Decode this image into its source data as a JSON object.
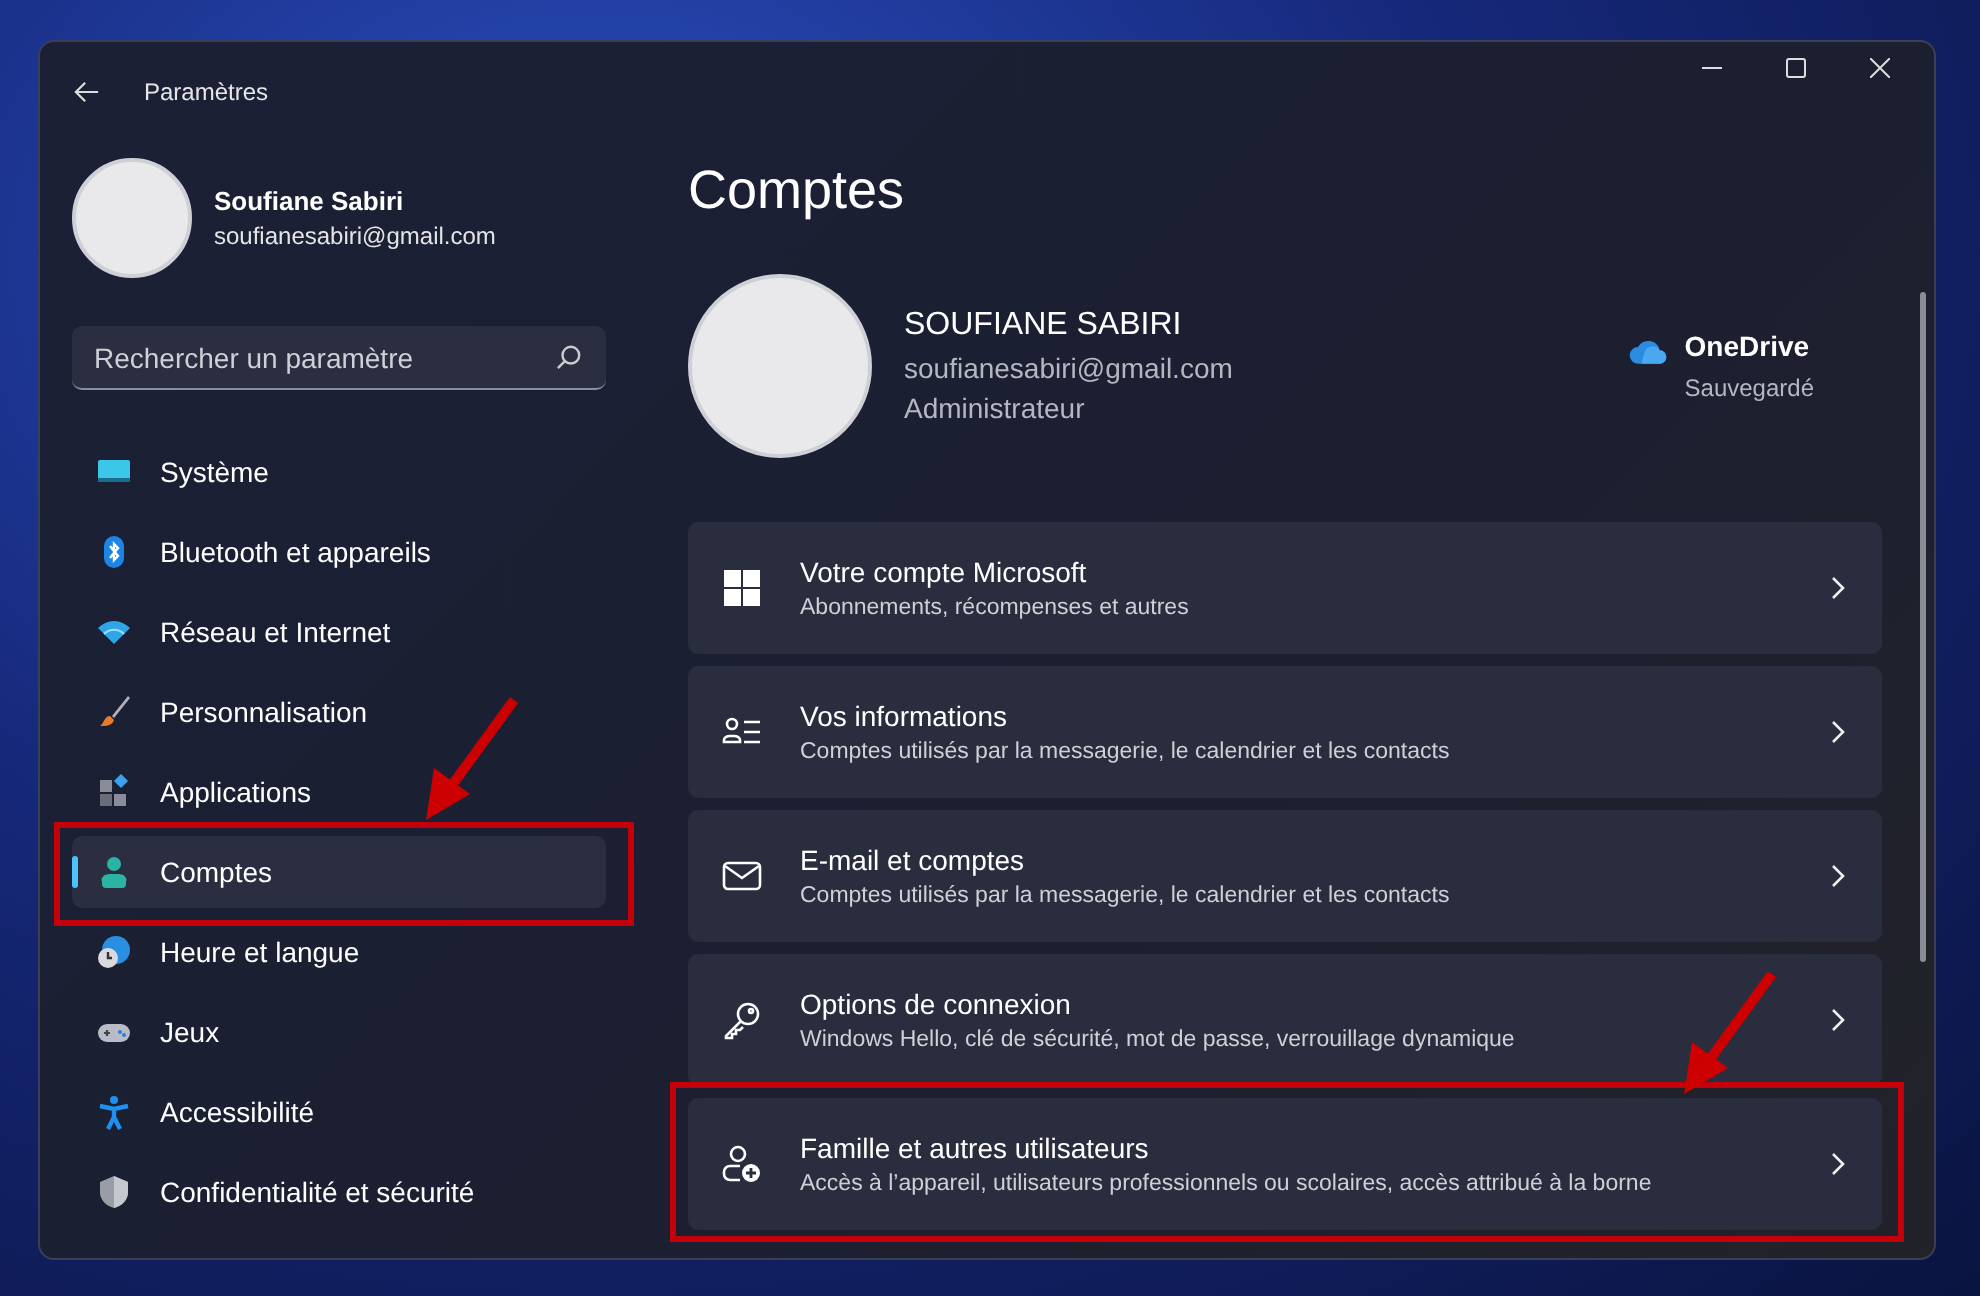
{
  "window": {
    "title": "Paramètres"
  },
  "profile": {
    "name": "Soufiane Sabiri",
    "email": "soufianesabiri@gmail.com"
  },
  "search": {
    "placeholder": "Rechercher un paramètre"
  },
  "nav": [
    {
      "label": "Système",
      "selected": false,
      "highlighted": false
    },
    {
      "label": "Bluetooth et appareils",
      "selected": false,
      "highlighted": false
    },
    {
      "label": "Réseau et Internet",
      "selected": false,
      "highlighted": false
    },
    {
      "label": "Personnalisation",
      "selected": false,
      "highlighted": false
    },
    {
      "label": "Applications",
      "selected": false,
      "highlighted": false
    },
    {
      "label": "Comptes",
      "selected": true,
      "highlighted": true
    },
    {
      "label": "Heure et langue",
      "selected": false,
      "highlighted": false
    },
    {
      "label": "Jeux",
      "selected": false,
      "highlighted": false
    },
    {
      "label": "Accessibilité",
      "selected": false,
      "highlighted": false
    },
    {
      "label": "Confidentialité et sécurité",
      "selected": false,
      "highlighted": false
    }
  ],
  "page": {
    "title": "Comptes"
  },
  "account": {
    "name": "SOUFIANE SABIRI",
    "email": "soufianesabiri@gmail.com",
    "role": "Administrateur"
  },
  "onedrive": {
    "title": "OneDrive",
    "status": "Sauvegardé"
  },
  "cards": [
    {
      "title": "Votre compte Microsoft",
      "subtitle": "Abonnements, récompenses et autres",
      "highlighted": false
    },
    {
      "title": "Vos informations",
      "subtitle": "Comptes utilisés par la messagerie, le calendrier et les contacts",
      "highlighted": false
    },
    {
      "title": "E-mail et comptes",
      "subtitle": "Comptes utilisés par la messagerie, le calendrier et les contacts",
      "highlighted": false
    },
    {
      "title": "Options de connexion",
      "subtitle": "Windows Hello, clé de sécurité, mot de passe, verrouillage dynamique",
      "highlighted": false
    },
    {
      "title": "Famille et autres utilisateurs",
      "subtitle": "Accès à l’appareil, utilisateurs professionnels ou scolaires, accès attribué à la borne",
      "highlighted": true
    }
  ]
}
